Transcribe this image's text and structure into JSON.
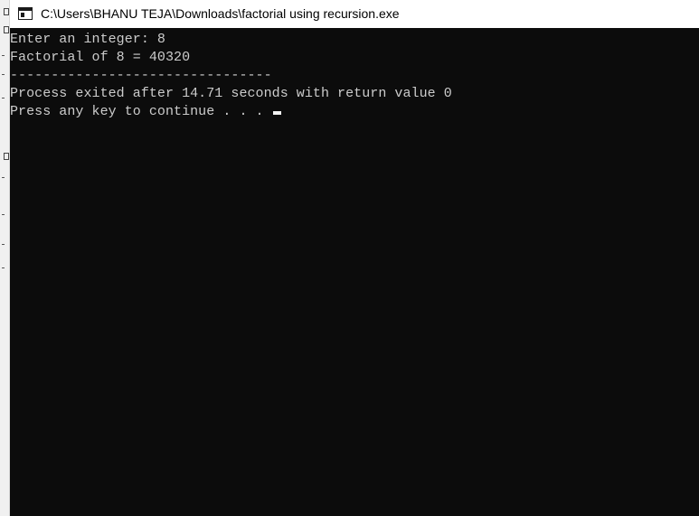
{
  "window": {
    "title": "C:\\Users\\BHANU TEJA\\Downloads\\factorial using recursion.exe",
    "icon": "console-app-icon"
  },
  "console": {
    "background": "#0c0c0c",
    "text_color": "#cccccc",
    "lines": [
      "Enter an integer: 8",
      "Factorial of 8 = 40320",
      "--------------------------------",
      "Process exited after 14.71 seconds with return value 0",
      "Press any key to continue . . . "
    ]
  }
}
